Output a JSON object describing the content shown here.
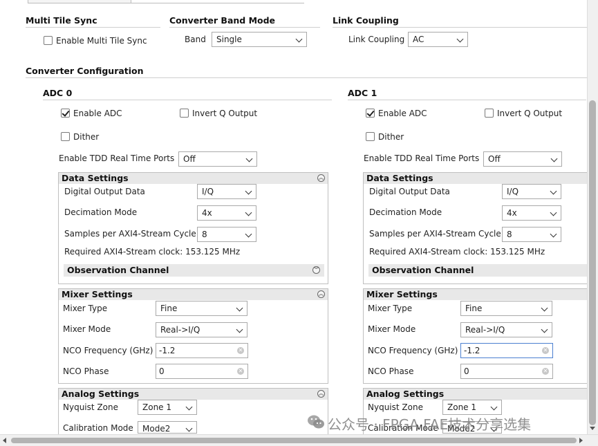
{
  "sync": {
    "title": "Multi Tile Sync",
    "enable_label": "Enable Multi Tile Sync"
  },
  "band": {
    "title": "Converter Band Mode",
    "label": "Band",
    "value": "Single"
  },
  "link": {
    "title": "Link Coupling",
    "label": "Link Coupling",
    "value": "AC"
  },
  "config": {
    "title": "Converter Configuration"
  },
  "adc0": {
    "title": "ADC 0",
    "enable_adc": "Enable ADC",
    "invert_q": "Invert Q Output",
    "dither": "Dither",
    "tdd_label": "Enable TDD Real Time Ports",
    "tdd_value": "Off",
    "data_settings": "Data Settings",
    "digital_output_label": "Digital Output Data",
    "digital_output_value": "I/Q",
    "decimation_label": "Decimation Mode",
    "decimation_value": "4x",
    "samples_label": "Samples per AXI4-Stream Cycle",
    "samples_value": "8",
    "required_clock": "Required AXI4-Stream clock: 153.125 MHz",
    "observation": "Observation Channel",
    "mixer_settings": "Mixer Settings",
    "mixer_type_label": "Mixer Type",
    "mixer_type_value": "Fine",
    "mixer_mode_label": "Mixer Mode",
    "mixer_mode_value": "Real->I/Q",
    "nco_freq_label": "NCO Frequency (GHz)",
    "nco_freq_value": "-1.2",
    "nco_phase_label": "NCO Phase",
    "nco_phase_value": "0",
    "analog_settings": "Analog Settings",
    "nyquist_label": "Nyquist Zone",
    "nyquist_value": "Zone 1",
    "calibration_label": "Calibration Mode",
    "calibration_value": "Mode2"
  },
  "adc1": {
    "title": "ADC 1",
    "enable_adc": "Enable ADC",
    "invert_q": "Invert Q Output",
    "dither": "Dither",
    "tdd_label": "Enable TDD Real Time Ports",
    "tdd_value": "Off",
    "data_settings": "Data Settings",
    "digital_output_label": "Digital Output Data",
    "digital_output_value": "I/Q",
    "decimation_label": "Decimation Mode",
    "decimation_value": "4x",
    "samples_label": "Samples per AXI4-Stream Cycle",
    "samples_value": "8",
    "required_clock": "Required AXI4-Stream clock: 153.125 MHz",
    "observation": "Observation Channel",
    "mixer_settings": "Mixer Settings",
    "mixer_type_label": "Mixer Type",
    "mixer_type_value": "Fine",
    "mixer_mode_label": "Mixer Mode",
    "mixer_mode_value": "Real->I/Q",
    "nco_freq_label": "NCO Frequency (GHz)",
    "nco_freq_value": "-1.2",
    "nco_phase_label": "NCO Phase",
    "nco_phase_value": "0",
    "analog_settings": "Analog Settings",
    "nyquist_label": "Nyquist Zone",
    "nyquist_value": "Zone 1",
    "calibration_label": "Calibration Mode",
    "calibration_value": "Mode2"
  },
  "watermark": "公众号 · FPGA FAE技术分享选集",
  "colors": {
    "focus": "#4a7fd0",
    "band_header": "#e8e8e8",
    "border": "#a9a9a9"
  }
}
